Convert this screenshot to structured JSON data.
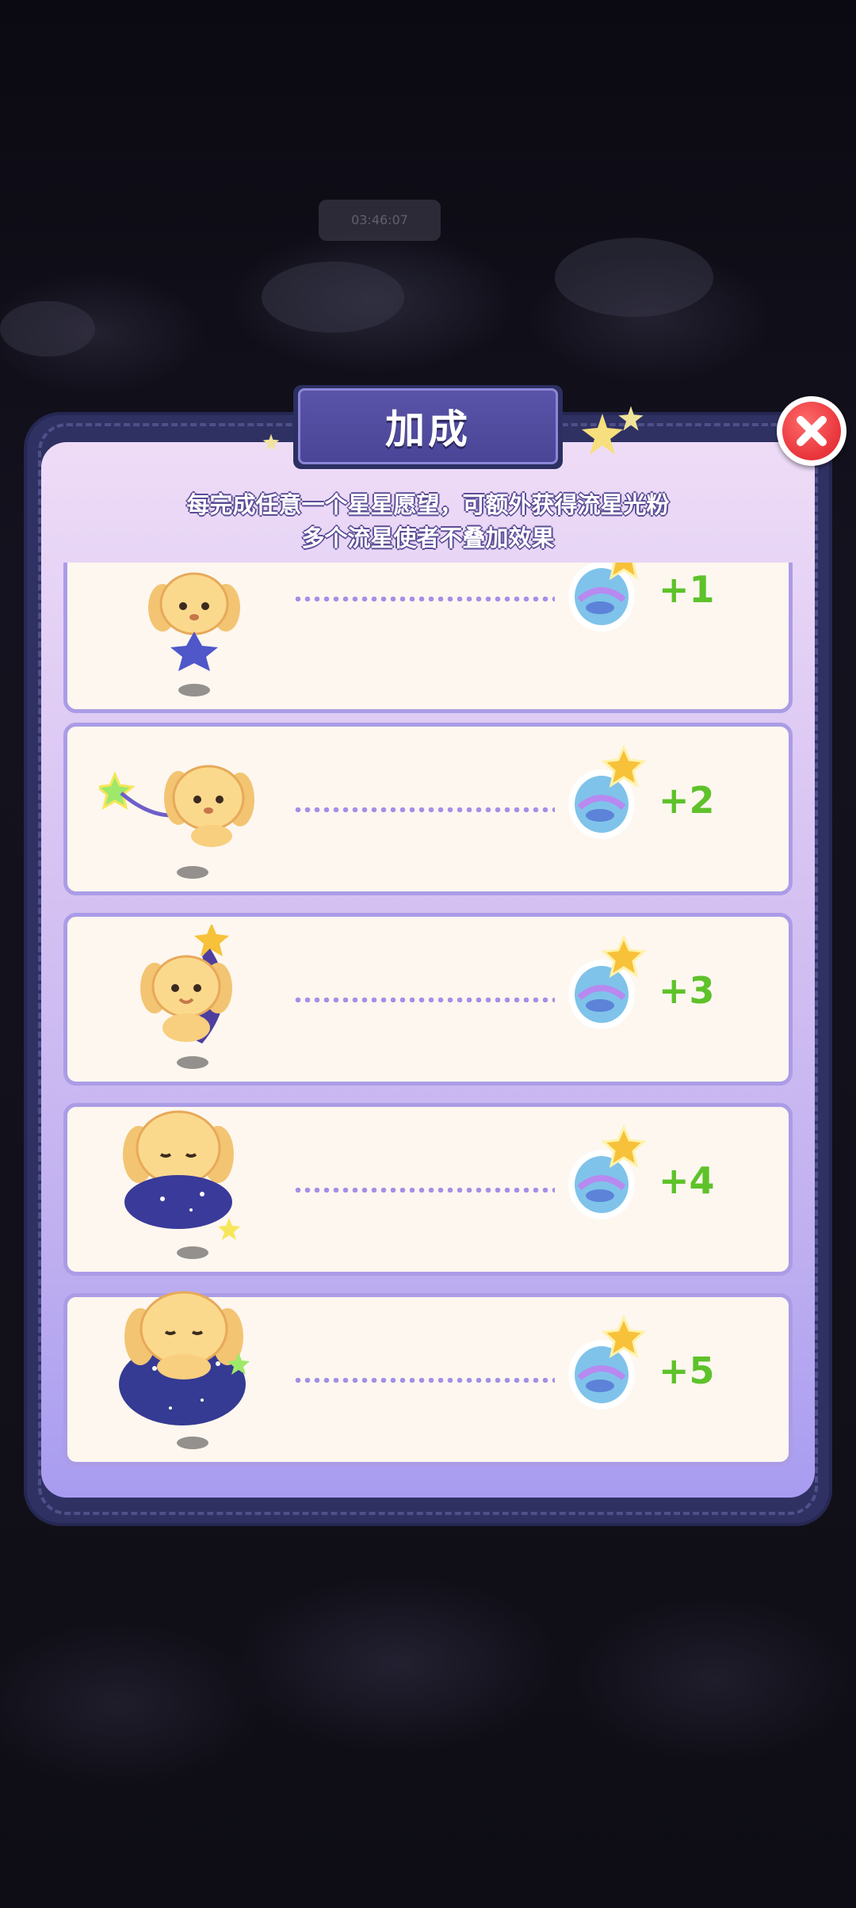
{
  "background": {
    "pill_label": "03:46:07"
  },
  "dialog": {
    "title": "加成",
    "description_line1": "每完成任意一个星星愿望，可额外获得流星光粉",
    "description_line2": "多个流星使者不叠加效果",
    "close_icon": "close-x-icon"
  },
  "rows": [
    {
      "bonus": "+1",
      "reward_icon": "meteor-dust-flask-icon"
    },
    {
      "bonus": "+2",
      "reward_icon": "meteor-dust-flask-icon"
    },
    {
      "bonus": "+3",
      "reward_icon": "meteor-dust-flask-icon"
    },
    {
      "bonus": "+4",
      "reward_icon": "meteor-dust-flask-icon"
    },
    {
      "bonus": "+5",
      "reward_icon": "meteor-dust-flask-icon"
    }
  ],
  "colors": {
    "panel_border": "#2f3163",
    "bonus_text": "#5ec22a",
    "close_button": "#e8343a",
    "dotted_line": "#a48fe6"
  }
}
